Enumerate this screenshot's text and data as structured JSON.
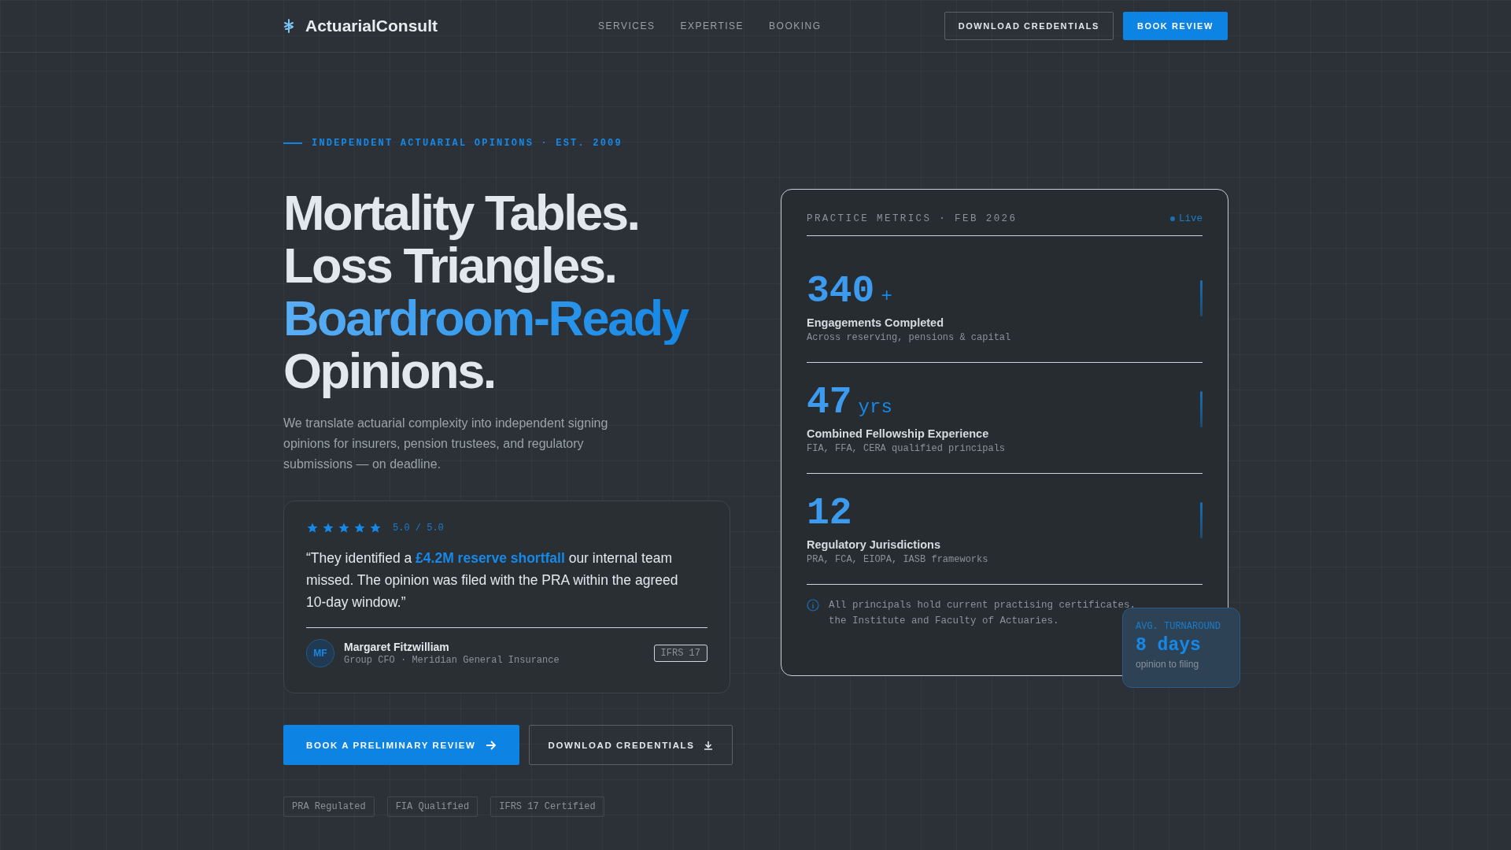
{
  "header": {
    "brand": "ActuarialConsult",
    "nav": [
      "SERVICES",
      "EXPERTISE",
      "BOOKING"
    ],
    "buttons": [
      {
        "label": "DOWNLOAD CREDENTIALS",
        "kind": "outline"
      },
      {
        "label": "BOOK REVIEW",
        "kind": "primary"
      }
    ]
  },
  "hero": {
    "eyebrow": "INDEPENDENT ACTUARIAL OPINIONS · EST. 2009",
    "headline": [
      {
        "text": "Mortality Tables.",
        "accent": false
      },
      {
        "text": "Loss Triangles.",
        "accent": false
      },
      {
        "text": "Boardroom-Ready",
        "accent": true
      },
      {
        "text": "Opinions.",
        "accent": false
      }
    ],
    "lead": "We translate actuarial complexity into independent signing opinions for insurers, pension trustees, and regulatory submissions — on deadline.",
    "testimonial": {
      "stars": 5,
      "rating": "5.0 / 5.0",
      "quote": "“They identified a **£4.2M reserve shortfall** our internal team missed. The opinion was filed with the PRA within the agreed 10-day window.”",
      "initials": "MF",
      "name": "Margaret Fitzwilliam",
      "role": "Group CFO · Meridian General Insurance",
      "tag": "IFRS 17"
    },
    "actions": [
      {
        "label": "BOOK A PRELIMINARY REVIEW",
        "kind": "primary"
      },
      {
        "label": "DOWNLOAD CREDENTIALS",
        "kind": "outline"
      }
    ],
    "badges": [
      "PRA Regulated",
      "FIA Qualified",
      "IFRS 17 Certified"
    ]
  },
  "metrics_card": {
    "title": "PRACTICE METRICS · FEB 2026",
    "status": "Live",
    "metrics": [
      {
        "value": "340",
        "unit": "+",
        "label": "Engagements Completed",
        "detail": "Across reserving, pensions & capital"
      },
      {
        "value": "47",
        "unit": "yrs",
        "label": "Combined Fellowship Experience",
        "detail": "FIA, FFA, CERA qualified principals"
      },
      {
        "value": "12",
        "label": "Regulatory Jurisdictions",
        "detail": "PRA, FCA, EIOPA, IASB frameworks"
      }
    ],
    "note_lines": [
      "All principals hold current practising certificates.",
      "the Institute and Faculty of Actuaries."
    ],
    "turnaround": {
      "label": "AVG. TURNAROUND",
      "value": "8 days",
      "caption": "opinion to filing"
    }
  }
}
